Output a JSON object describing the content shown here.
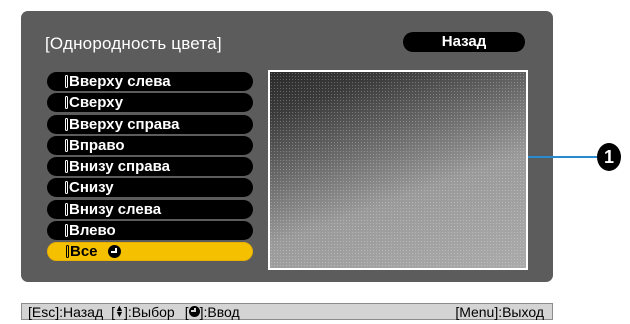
{
  "screen": {
    "title": "[Однородность цвета]",
    "back_label": "Назад"
  },
  "menu": {
    "items": [
      {
        "label": "Вверху слева",
        "selected": false
      },
      {
        "label": "Сверху",
        "selected": false
      },
      {
        "label": "Вверху справа",
        "selected": false
      },
      {
        "label": "Вправо",
        "selected": false
      },
      {
        "label": "Внизу справа",
        "selected": false
      },
      {
        "label": "Снизу",
        "selected": false
      },
      {
        "label": "Внизу слева",
        "selected": false
      },
      {
        "label": "Влево",
        "selected": false
      },
      {
        "label": "Все",
        "selected": true,
        "icon": "enter-icon"
      }
    ]
  },
  "callout": {
    "number": "1"
  },
  "footer": {
    "esc_label": "[Esc]:Назад",
    "select_open": "[",
    "select_icon": "up-down-arrow-icon",
    "select_close": "]:Выбор",
    "enter_open": "[",
    "enter_icon": "enter-icon",
    "enter_close": "]:Ввод",
    "menu_label": "[Menu]:Выход"
  },
  "colors": {
    "panel": "#5c5c5c",
    "item_bg": "#000000",
    "selected_bg": "#f5c000",
    "callout_line": "#2a8ad0",
    "footer_bg": "#d4d4d4"
  }
}
